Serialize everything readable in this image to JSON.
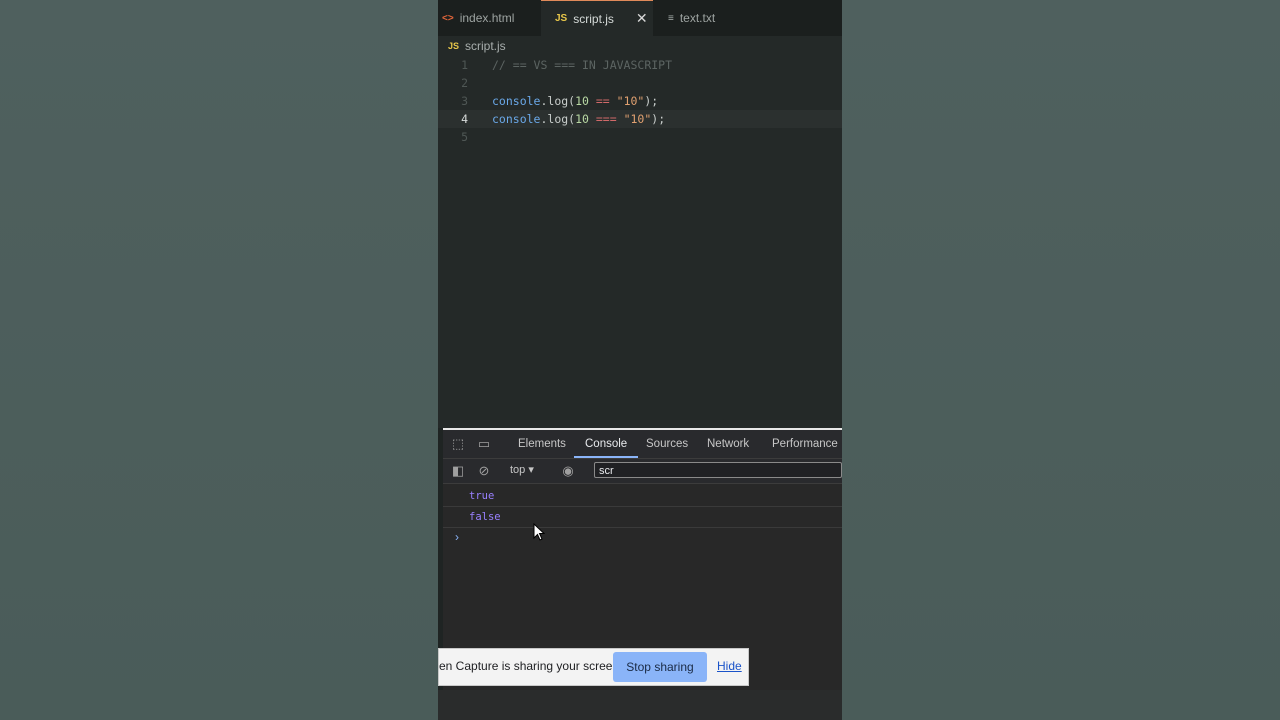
{
  "editor": {
    "tabs": [
      {
        "icon": "html-file-icon",
        "label": "index.html"
      },
      {
        "icon": "js-file-icon",
        "label": "script.js",
        "active": true
      },
      {
        "icon": "text-file-icon",
        "label": "text.txt"
      }
    ],
    "js_badge": "JS",
    "breadcrumb": "script.js",
    "lines": [
      {
        "n": "1",
        "text": "// == VS === IN JAVASCRIPT"
      },
      {
        "n": "2",
        "text": ""
      },
      {
        "n": "3",
        "text": "console.log(10 == \"10\");"
      },
      {
        "n": "4",
        "text": "console.log(10 === \"10\");"
      },
      {
        "n": "5",
        "text": ""
      }
    ],
    "line3": {
      "obj": "console",
      "dot": ".log(",
      "num": "10",
      "op": " == ",
      "str": "\"10\"",
      "end": ");"
    },
    "line4": {
      "obj": "console",
      "dot": ".log(",
      "num": "10",
      "op": " === ",
      "str": "\"10\"",
      "end": ");"
    },
    "current_line": "4"
  },
  "devtools": {
    "tabs": [
      "Elements",
      "Console",
      "Sources",
      "Network",
      "Performance"
    ],
    "active_tab": "Console",
    "context": "top",
    "filter_value": "scr",
    "output": [
      "true",
      "false"
    ],
    "prompt": "›"
  },
  "share_bar": {
    "message": "en Capture is sharing your screen.",
    "stop_label": "Stop sharing",
    "hide_label": "Hide"
  },
  "colors": {
    "accent": "#8ab4f8",
    "editor_bg": "#242928",
    "console_value": "#9980ff"
  }
}
